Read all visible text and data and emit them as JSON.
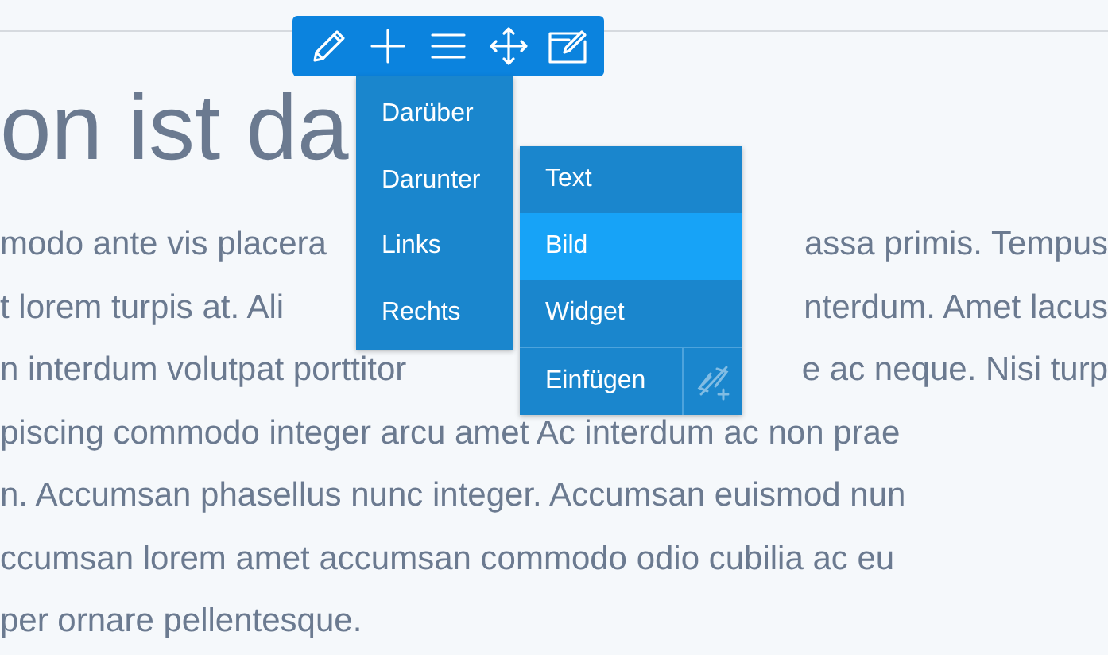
{
  "heading": "on ist da",
  "paragraph_lines": [
    {
      "left": "modo ante vis placera",
      "right": "assa primis. Tempus"
    },
    {
      "left": "t lorem turpis at. Ali",
      "right": "nterdum. Amet lacus"
    },
    {
      "left": "n interdum volutpat porttitor",
      "right": "e ac neque. Nisi turp"
    },
    {
      "left": "piscing commodo integer arcu amet Ac interdum ac non prae"
    },
    {
      "left": "n. Accumsan phasellus nunc integer. Accumsan euismod nun"
    },
    {
      "left": "ccumsan lorem amet accumsan commodo odio cubilia ac eu"
    },
    {
      "left": "per ornare pellentesque."
    }
  ],
  "menu": {
    "items": [
      {
        "label": "Darüber",
        "selected": false
      },
      {
        "label": "Darunter",
        "selected": false
      },
      {
        "label": "Links",
        "selected": false
      },
      {
        "label": "Rechts",
        "selected": false
      }
    ]
  },
  "submenu": {
    "items": [
      {
        "label": "Text",
        "selected": false
      },
      {
        "label": "Bild",
        "selected": true
      },
      {
        "label": "Widget",
        "selected": false
      }
    ],
    "insert": {
      "label": "Einfügen",
      "icon_disabled": true
    }
  }
}
